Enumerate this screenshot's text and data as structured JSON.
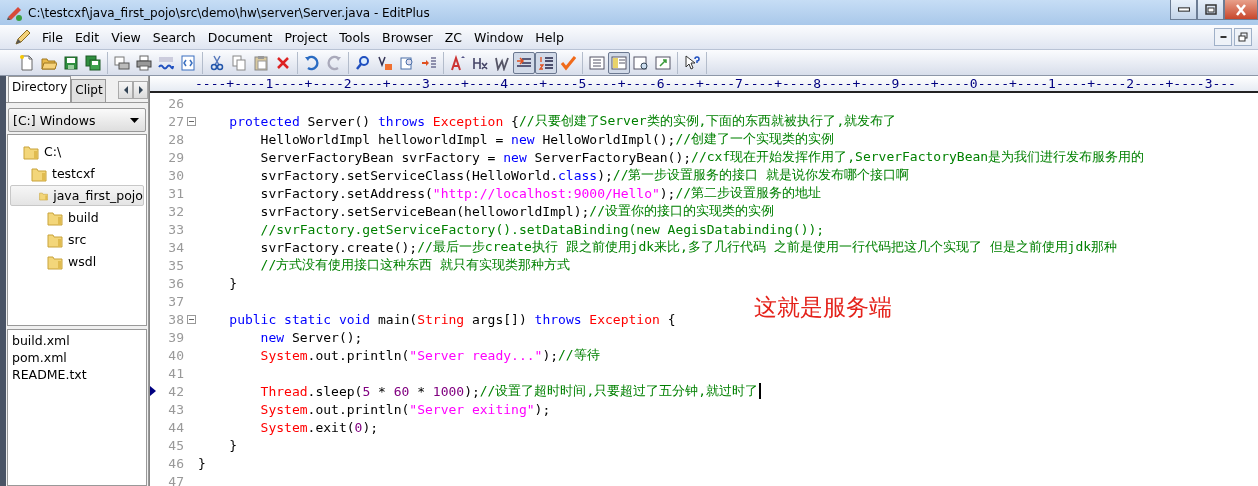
{
  "window": {
    "title": "C:\\testcxf\\java_first_pojo\\src\\demo\\hw\\server\\Server.java - EditPlus"
  },
  "menu": [
    "File",
    "Edit",
    "View",
    "Search",
    "Document",
    "Project",
    "Tools",
    "Browser",
    "ZC",
    "Window",
    "Help"
  ],
  "toolbar": [
    [
      {
        "kind": "new",
        "pressed": false
      },
      {
        "kind": "open",
        "pressed": false
      },
      {
        "kind": "save",
        "pressed": false
      },
      {
        "kind": "saveall",
        "pressed": false
      }
    ],
    [
      {
        "kind": "preview",
        "pressed": false
      },
      {
        "kind": "print",
        "pressed": false
      },
      {
        "kind": "spell",
        "pressed": false
      },
      {
        "kind": "html",
        "pressed": false
      }
    ],
    [
      {
        "kind": "cut",
        "pressed": false
      },
      {
        "kind": "copy",
        "pressed": false
      },
      {
        "kind": "paste",
        "pressed": false
      },
      {
        "kind": "delete",
        "pressed": false
      }
    ],
    [
      {
        "kind": "undo",
        "pressed": false
      },
      {
        "kind": "redo",
        "pressed": false
      }
    ],
    [
      {
        "kind": "find",
        "pressed": false
      },
      {
        "kind": "replace",
        "pressed": false
      },
      {
        "kind": "findfiles",
        "pressed": false
      },
      {
        "kind": "goto",
        "pressed": false
      }
    ],
    [
      {
        "kind": "font",
        "pressed": false
      },
      {
        "kind": "heading",
        "pressed": false
      },
      {
        "kind": "italic",
        "pressed": false
      },
      {
        "kind": "wrap",
        "pressed": true
      },
      {
        "kind": "linenum",
        "pressed": true
      },
      {
        "kind": "check",
        "pressed": false
      }
    ],
    [
      {
        "kind": "list",
        "pressed": false
      },
      {
        "kind": "panel",
        "pressed": true
      },
      {
        "kind": "clip",
        "pressed": false
      },
      {
        "kind": "output",
        "pressed": false
      }
    ],
    [
      {
        "kind": "help",
        "pressed": false
      }
    ]
  ],
  "side_tabs": [
    {
      "label": "Directory",
      "selected": true
    },
    {
      "label": "Clipt",
      "selected": false
    }
  ],
  "drive": "[C:] Windows",
  "tree": [
    {
      "label": "C:\\",
      "selected": false,
      "children": [
        {
          "label": "testcxf",
          "selected": false,
          "children": [
            {
              "label": "java_first_pojo",
              "selected": true,
              "children": [
                {
                  "label": "build",
                  "selected": false
                },
                {
                  "label": "src",
                  "selected": false
                },
                {
                  "label": "wsdl",
                  "selected": false
                }
              ]
            }
          ]
        }
      ]
    }
  ],
  "files": [
    "build.xml",
    "pom.xml",
    "README.txt"
  ],
  "ruler": "----+----1----+----2----+----3----+----4----+----5----+----6----+----7----+----8----+----9----+----0----+----1----+----2----+----3---",
  "lines": [
    {
      "number": "26",
      "fold": false,
      "bookmark": false,
      "cursor": false
    },
    {
      "number": "27",
      "fold": true,
      "bookmark": false,
      "cursor": false,
      "tokens": [
        {
          "kind": "keyword",
          "text": "    protected"
        },
        {
          "kind": "plain",
          "text": " Server() "
        },
        {
          "kind": "keyword",
          "text": "throws"
        },
        {
          "kind": "type",
          "text": " Exception"
        },
        {
          "kind": "plain",
          "text": " {"
        },
        {
          "kind": "comment",
          "text": "//只要创建了Server类的实例,下面的东西就被执行了,就发布了"
        }
      ]
    },
    {
      "number": "28",
      "fold": false,
      "bookmark": false,
      "cursor": false,
      "tokens": [
        {
          "kind": "plain",
          "text": "        HelloWorldImpl helloworldImpl = "
        },
        {
          "kind": "keyword",
          "text": "new"
        },
        {
          "kind": "plain",
          "text": " HelloWorldImpl();"
        },
        {
          "kind": "comment",
          "text": "//创建了一个实现类的实例"
        }
      ]
    },
    {
      "number": "29",
      "fold": false,
      "bookmark": false,
      "cursor": false,
      "tokens": [
        {
          "kind": "plain",
          "text": "        ServerFactoryBean svrFactory = "
        },
        {
          "kind": "keyword",
          "text": "new"
        },
        {
          "kind": "plain",
          "text": " ServerFactoryBean();"
        },
        {
          "kind": "comment",
          "text": "//cxf现在开始发挥作用了,ServerFactoryBean是为我们进行发布服务用的"
        }
      ]
    },
    {
      "number": "30",
      "fold": false,
      "bookmark": false,
      "cursor": false,
      "tokens": [
        {
          "kind": "plain",
          "text": "        svrFactory.setServiceClass(HelloWorld."
        },
        {
          "kind": "keyword",
          "text": "class"
        },
        {
          "kind": "plain",
          "text": ");"
        },
        {
          "kind": "comment",
          "text": "//第一步设置服务的接口 就是说你发布哪个接口啊"
        }
      ]
    },
    {
      "number": "31",
      "fold": false,
      "bookmark": false,
      "cursor": false,
      "tokens": [
        {
          "kind": "plain",
          "text": "        svrFactory.setAddress("
        },
        {
          "kind": "string",
          "text": "\"http://localhost:9000/Hello\""
        },
        {
          "kind": "plain",
          "text": ");"
        },
        {
          "kind": "comment",
          "text": "//第二步设置服务的地址"
        }
      ]
    },
    {
      "number": "32",
      "fold": false,
      "bookmark": false,
      "cursor": false,
      "tokens": [
        {
          "kind": "plain",
          "text": "        svrFactory.setServiceBean(helloworldImpl);"
        },
        {
          "kind": "comment",
          "text": "//设置你的接口的实现类的实例"
        }
      ]
    },
    {
      "number": "33",
      "fold": false,
      "bookmark": false,
      "cursor": false,
      "tokens": [
        {
          "kind": "comment",
          "text": "        //svrFactory.getServiceFactory().setDataBinding(new AegisDatabinding());"
        }
      ]
    },
    {
      "number": "34",
      "fold": false,
      "bookmark": false,
      "cursor": false,
      "tokens": [
        {
          "kind": "plain",
          "text": "        svrFactory.create();"
        },
        {
          "kind": "comment",
          "text": "//最后一步create执行 跟之前使用jdk来比,多了几行代码 之前是使用一行代码把这几个实现了 但是之前使用jdk那种"
        }
      ]
    },
    {
      "number": "35",
      "fold": false,
      "bookmark": false,
      "cursor": false,
      "tokens": [
        {
          "kind": "comment",
          "text": "        //方式没有使用接口这种东西 就只有实现类那种方式"
        }
      ]
    },
    {
      "number": "36",
      "fold": false,
      "bookmark": false,
      "cursor": false,
      "tokens": [
        {
          "kind": "plain",
          "text": "    }"
        }
      ]
    },
    {
      "number": "37",
      "fold": false,
      "bookmark": false,
      "cursor": false
    },
    {
      "number": "38",
      "fold": true,
      "bookmark": false,
      "cursor": false,
      "tokens": [
        {
          "kind": "keyword",
          "text": "    public static void"
        },
        {
          "kind": "plain",
          "text": " main("
        },
        {
          "kind": "type",
          "text": "String"
        },
        {
          "kind": "plain",
          "text": " args[]) "
        },
        {
          "kind": "keyword",
          "text": "throws"
        },
        {
          "kind": "type",
          "text": " Exception"
        },
        {
          "kind": "plain",
          "text": " {"
        }
      ]
    },
    {
      "number": "39",
      "fold": false,
      "bookmark": false,
      "cursor": false,
      "tokens": [
        {
          "kind": "keyword",
          "text": "        new"
        },
        {
          "kind": "plain",
          "text": " Server();"
        }
      ]
    },
    {
      "number": "40",
      "fold": false,
      "bookmark": false,
      "cursor": false,
      "tokens": [
        {
          "kind": "type",
          "text": "        System"
        },
        {
          "kind": "plain",
          "text": ".out.println("
        },
        {
          "kind": "string",
          "text": "\"Server ready...\""
        },
        {
          "kind": "plain",
          "text": ");"
        },
        {
          "kind": "comment",
          "text": "//等待"
        }
      ]
    },
    {
      "number": "41",
      "fold": false,
      "bookmark": false,
      "cursor": false
    },
    {
      "number": "42",
      "fold": false,
      "bookmark": true,
      "cursor": true,
      "tokens": [
        {
          "kind": "type",
          "text": "        Thread"
        },
        {
          "kind": "plain",
          "text": ".sleep("
        },
        {
          "kind": "number",
          "text": "5"
        },
        {
          "kind": "plain",
          "text": " * "
        },
        {
          "kind": "number",
          "text": "60"
        },
        {
          "kind": "plain",
          "text": " * "
        },
        {
          "kind": "number",
          "text": "1000"
        },
        {
          "kind": "plain",
          "text": ");"
        },
        {
          "kind": "comment",
          "text": "//设置了超时时间,只要超过了五分钟,就过时了"
        }
      ]
    },
    {
      "number": "43",
      "fold": false,
      "bookmark": false,
      "cursor": false,
      "tokens": [
        {
          "kind": "type",
          "text": "        System"
        },
        {
          "kind": "plain",
          "text": ".out.println("
        },
        {
          "kind": "string",
          "text": "\"Server exiting\""
        },
        {
          "kind": "plain",
          "text": ");"
        }
      ]
    },
    {
      "number": "44",
      "fold": false,
      "bookmark": false,
      "cursor": false,
      "tokens": [
        {
          "kind": "type",
          "text": "        System"
        },
        {
          "kind": "plain",
          "text": ".exit("
        },
        {
          "kind": "number",
          "text": "0"
        },
        {
          "kind": "plain",
          "text": ");"
        }
      ]
    },
    {
      "number": "45",
      "fold": false,
      "bookmark": false,
      "cursor": false,
      "tokens": [
        {
          "kind": "plain",
          "text": "    }"
        }
      ]
    },
    {
      "number": "46",
      "fold": false,
      "bookmark": false,
      "cursor": false,
      "tokens": [
        {
          "kind": "plain",
          "text": "}"
        }
      ]
    },
    {
      "number": "47",
      "fold": false,
      "bookmark": false,
      "cursor": false
    }
  ],
  "annotation": "这就是服务端"
}
